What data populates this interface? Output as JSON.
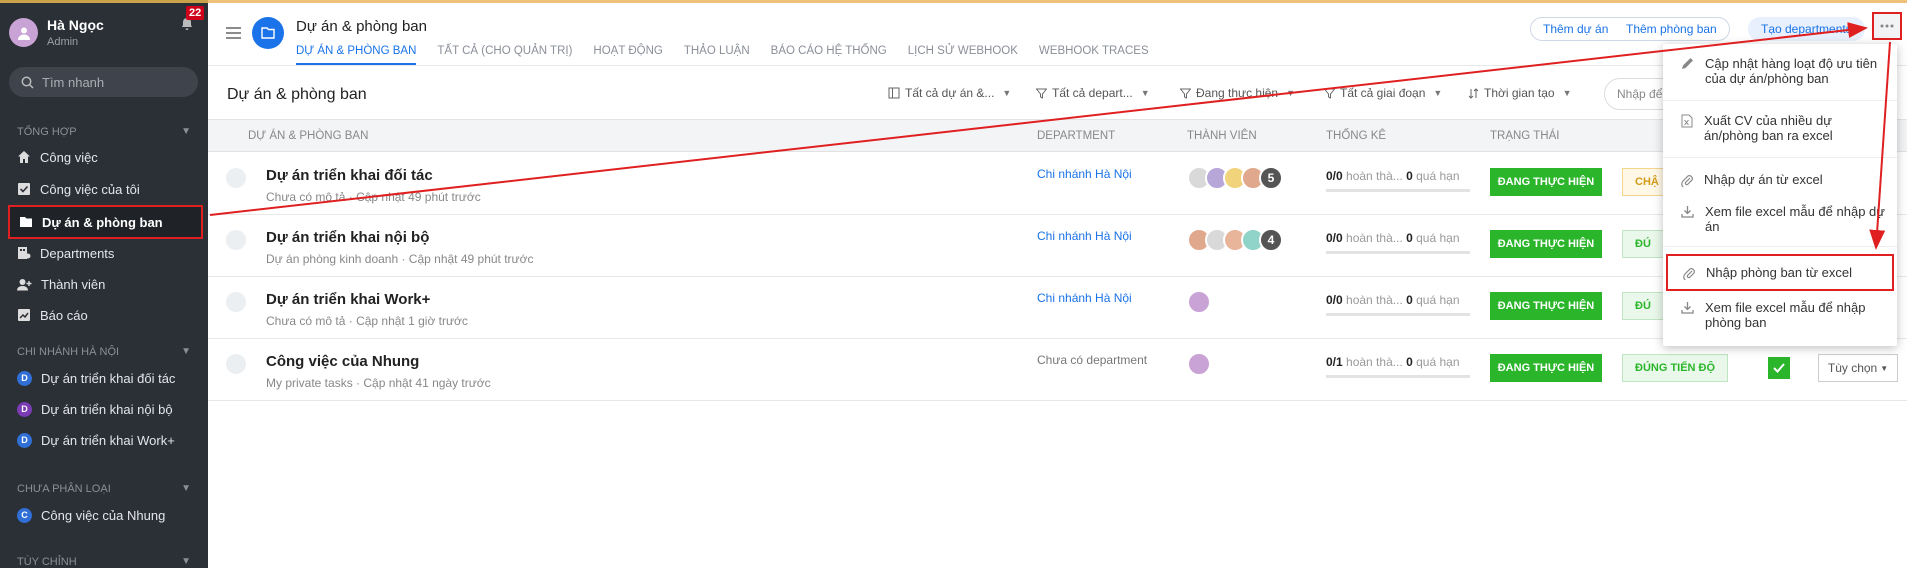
{
  "sidebar": {
    "user_name": "Hà Ngọc",
    "user_role": "Admin",
    "notif_count": "22",
    "search_placeholder": "Tìm nhanh",
    "sections": {
      "overview": "Tổng hợp",
      "branch": "Chi nhánh Hà Nội",
      "uncategorized": "Chưa phân loại",
      "custom": "Tùy chỉnh"
    },
    "items": {
      "tasks": "Công việc",
      "my_tasks": "Công việc của tôi",
      "projects": "Dự án & phòng ban",
      "departments": "Departments",
      "members": "Thành viên",
      "reports": "Báo cáo"
    },
    "branch_projects": [
      {
        "letter": "D",
        "label": "Dự án triển khai đối tác",
        "color": "#2f6fd6"
      },
      {
        "letter": "D",
        "label": "Dự án triển khai nội bộ",
        "color": "#7a3bb5"
      },
      {
        "letter": "D",
        "label": "Dự án triển khai Work+",
        "color": "#2f6fd6"
      }
    ],
    "uncategorized_projects": [
      {
        "letter": "C",
        "label": "Công việc của Nhung",
        "color": "#2f6fd6"
      }
    ]
  },
  "header": {
    "title": "Dự án & phòng ban",
    "tabs": [
      "DỰ ÁN & PHÒNG BAN",
      "TẤT CẢ (CHO QUẢN TRỊ)",
      "HOẠT ĐỘNG",
      "THẢO LUẬN",
      "BÁO CÁO HỆ THỐNG",
      "LỊCH SỬ WEBHOOK",
      "WEBHOOK TRACES"
    ],
    "btn_add_project": "Thêm dự án",
    "btn_add_department": "Thêm phòng ban",
    "btn_create_departments": "Tạo departments"
  },
  "toolbar": {
    "title": "Dự án & phòng ban",
    "filter_projects": "Tất cả dự án &...",
    "filter_departments": "Tất cả depart...",
    "filter_status": "Đang thực hiện",
    "filter_stage": "Tất cả giai đoạn",
    "filter_time": "Thời gian tạo",
    "search_placeholder": "Nhập để"
  },
  "table": {
    "headers": {
      "name": "Dự án & phòng ban",
      "department": "Department",
      "members": "Thành viên",
      "stats": "Thống kê",
      "status": "Trạng thái"
    },
    "rows": [
      {
        "name": "Dự án triển khai đối tác",
        "sub": "Chưa có mô tả · Cập nhật 49 phút trước",
        "department": "Chi nhánh Hà Nội",
        "member_more": "5",
        "stat_done": "0/0",
        "stat_done_label": "hoàn thà...",
        "stat_overdue": "0",
        "stat_overdue_label": "quá hạn",
        "status": "ĐANG THỰC HIỆN",
        "progress": "CHẬ"
      },
      {
        "name": "Dự án triển khai nội bộ",
        "sub": "Dự án phòng kinh doanh · Cập nhật 49 phút trước",
        "department": "Chi nhánh Hà Nội",
        "member_more": "4",
        "stat_done": "0/0",
        "stat_done_label": "hoàn thà...",
        "stat_overdue": "0",
        "stat_overdue_label": "quá hạn",
        "status": "ĐANG THỰC HIỆN",
        "progress": "ĐÚ"
      },
      {
        "name": "Dự án triển khai Work+",
        "sub": "Chưa có mô tả · Cập nhật 1 giờ trước",
        "department": "Chi nhánh Hà Nội",
        "member_more": "",
        "stat_done": "0/0",
        "stat_done_label": "hoàn thà...",
        "stat_overdue": "0",
        "stat_overdue_label": "quá hạn",
        "status": "ĐANG THỰC HIỆN",
        "progress": "ĐÚ"
      },
      {
        "name": "Công việc của Nhung",
        "sub": "My private tasks · Cập nhật 41 ngày trước",
        "department": "Chưa có department",
        "member_more": "",
        "stat_done": "0/1",
        "stat_done_label": "hoàn thà...",
        "stat_overdue": "0",
        "stat_overdue_label": "quá hạn",
        "status": "ĐANG THỰC HIỆN",
        "progress": "ĐÚNG TIẾN ĐỘ",
        "choose": "Tùy chọn"
      }
    ]
  },
  "menu": {
    "items": [
      "Cập nhật hàng loạt độ ưu tiên của dự án/phòng ban",
      "Xuất CV của nhiều dự án/phòng ban ra excel",
      "Nhập dự án từ excel",
      "Xem file excel mẫu để nhập dự án",
      "Nhập phòng ban từ excel",
      "Xem file excel mẫu để nhập phòng ban"
    ]
  },
  "colors": {
    "accent": "#1a73e8",
    "success": "#2bb52b",
    "sidebar": "#2b2f36",
    "annotation": "#e02020"
  }
}
